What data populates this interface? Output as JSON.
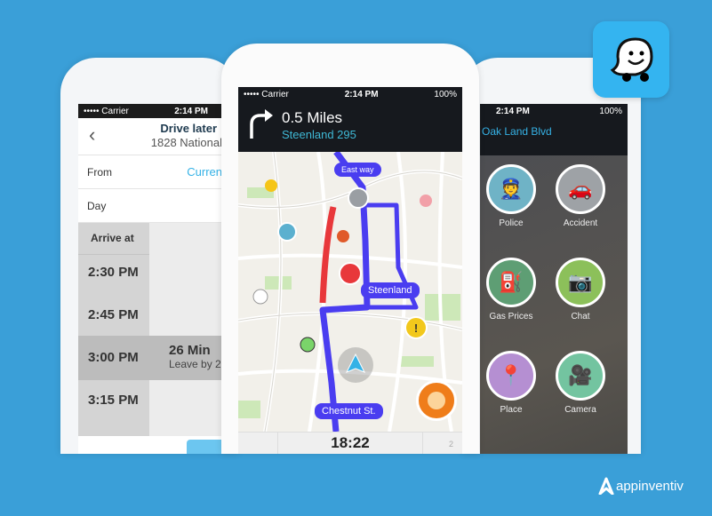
{
  "colors": {
    "background": "#3a9fd8",
    "route": "#4a3df0",
    "traffic": "#e8383b",
    "accent": "#35b2e6"
  },
  "left_phone": {
    "status": {
      "carrier": "••••• Carrier",
      "time": "2:14 PM"
    },
    "header": {
      "title": "Drive later",
      "subtitle": "1828 National"
    },
    "from_label": "From",
    "from_value": "Curren",
    "day_label": "Day",
    "arrive_label": "Arrive at",
    "times": [
      "2:30 PM",
      "2:45 PM",
      "3:00 PM",
      "3:15 PM"
    ],
    "selected": {
      "duration": "26 Min",
      "leave": "Leave by 2"
    }
  },
  "center_phone": {
    "status": {
      "carrier": "••••• Carrier",
      "time": "2:14 PM",
      "battery": "100%"
    },
    "instruction": {
      "distance": "0.5 Miles",
      "street": "Steenland 295"
    },
    "labels": {
      "east": "East way",
      "steenland": "Steenland",
      "chestnut": "Chestnut St."
    },
    "eta": "18:22",
    "riders": "2"
  },
  "right_phone": {
    "status": {
      "time": "2:14 PM",
      "battery": "100%"
    },
    "street": "Oak Land Blvd",
    "reports": [
      {
        "label": "Police",
        "icon": "police-icon",
        "color": "#6fb3c6"
      },
      {
        "label": "Accident",
        "icon": "accident-icon",
        "color": "#9ea2a6"
      },
      {
        "label": "Gas Prices",
        "icon": "gas-pump-icon",
        "color": "#5e9e74"
      },
      {
        "label": "Chat",
        "icon": "chat-camera-icon",
        "color": "#8cc05a"
      },
      {
        "label": "Place",
        "icon": "place-icon",
        "color": "#b58fd2"
      },
      {
        "label": "Camera",
        "icon": "speed-camera-icon",
        "color": "#73c4a0"
      }
    ]
  },
  "brand": {
    "name": "appinventiv",
    "app_logo": "waze-logo"
  }
}
